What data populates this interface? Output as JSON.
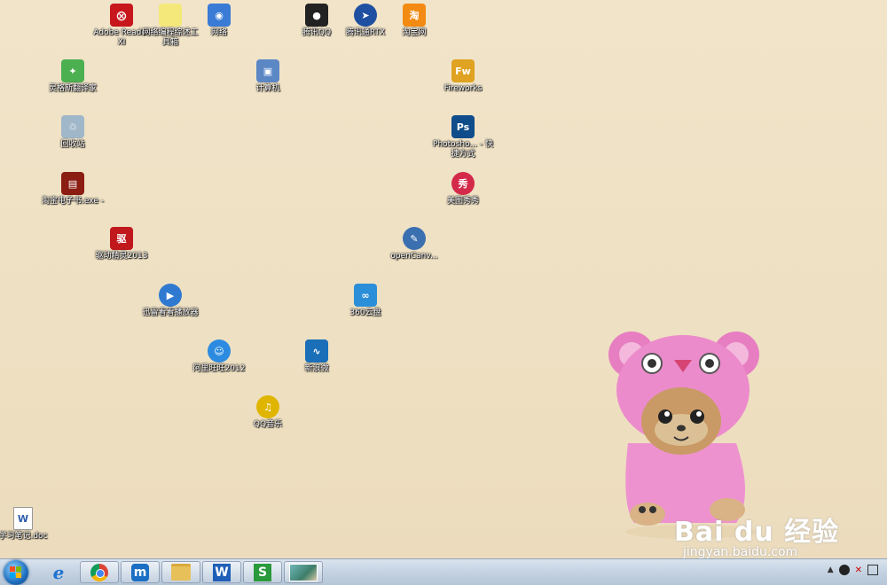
{
  "desktop": {
    "icons": [
      {
        "label": "Adobe Reader XI",
        "glyph": "⨂",
        "color": "#c8161d",
        "icon": "adobe-reader-icon"
      },
      {
        "label": "网络编程综述工具箱",
        "glyph": "",
        "color": "#f5e87a",
        "icon": "sticky-note-icon"
      },
      {
        "label": "网络",
        "glyph": "◉",
        "color": "#3a7bd5",
        "icon": "network-icon"
      },
      {
        "label": "腾讯QQ",
        "glyph": "●",
        "color": "#222",
        "icon": "qq-icon"
      },
      {
        "label": "腾讯通RTX",
        "glyph": "➤",
        "color": "#1f4fa0",
        "icon": "rtx-icon"
      },
      {
        "label": "淘宝网",
        "glyph": "淘",
        "color": "#f38a12",
        "icon": "taobao-icon"
      },
      {
        "label": "灵格斯翻译家",
        "glyph": "✦",
        "color": "#4caf50",
        "icon": "lingoes-icon"
      },
      {
        "label": "计算机",
        "glyph": "▣",
        "color": "#5b87c5",
        "icon": "computer-icon"
      },
      {
        "label": "Fireworks",
        "glyph": "Fw",
        "color": "#e0a321",
        "icon": "fireworks-icon"
      },
      {
        "label": "回收站",
        "glyph": "♲",
        "color": "#9fb7c9",
        "icon": "recycle-bin-icon"
      },
      {
        "label": "Photosho... - 快捷方式",
        "glyph": "Ps",
        "color": "#0f4c8a",
        "icon": "photoshop-icon"
      },
      {
        "label": "淘宝电子书.exe -",
        "glyph": "▤",
        "color": "#8b1d12",
        "icon": "ebook-icon"
      },
      {
        "label": "美图秀秀",
        "glyph": "秀",
        "color": "#d42a4a",
        "icon": "meitu-icon"
      },
      {
        "label": "驱动精灵2013",
        "glyph": "驱",
        "color": "#c0181c",
        "icon": "driver-genius-icon"
      },
      {
        "label": "openCanv...",
        "glyph": "✎",
        "color": "#3a6fb0",
        "icon": "opencanvas-icon"
      },
      {
        "label": "迅雷看看播放器",
        "glyph": "▶",
        "color": "#2f7ad0",
        "icon": "xunlei-kankan-icon"
      },
      {
        "label": "360云盘",
        "glyph": "∞",
        "color": "#2b8ed8",
        "icon": "cloud-disk-icon"
      },
      {
        "label": "阿里旺旺2012",
        "glyph": "☺",
        "color": "#2c8be0",
        "icon": "aliwangwang-icon"
      },
      {
        "label": "新浪微",
        "glyph": "∿",
        "color": "#1a6fb8",
        "icon": "weibo-icon"
      },
      {
        "label": "QQ音乐",
        "glyph": "♫",
        "color": "#e0b500",
        "icon": "qq-music-icon"
      },
      {
        "label": "学习笔记.doc",
        "glyph": "W",
        "color": "#ffffff",
        "icon": "word-doc-icon"
      }
    ]
  },
  "taskbar": {
    "items": [
      {
        "name": "ie",
        "glyph": "e",
        "color": "#1e73d2",
        "icon": "internet-explorer-icon"
      },
      {
        "name": "chrome",
        "glyph": "◎",
        "color": "#d93025",
        "icon": "chrome-icon"
      },
      {
        "name": "maxthon",
        "glyph": "m",
        "color": "#1a6fc4",
        "icon": "maxthon-icon"
      },
      {
        "name": "explorer",
        "glyph": "▭",
        "color": "#e7c05a",
        "icon": "folder-icon"
      },
      {
        "name": "wps-writer",
        "glyph": "W",
        "color": "#1f5fb8",
        "icon": "wps-writer-icon"
      },
      {
        "name": "wps-spreadsheet",
        "glyph": "S",
        "color": "#2a9a3c",
        "icon": "wps-spreadsheet-icon"
      },
      {
        "name": "image-viewer",
        "glyph": "▦",
        "color": "#5aa1a6",
        "icon": "image-viewer-icon"
      }
    ]
  },
  "watermark": {
    "brand": "Bai du 经验",
    "url": "jingyan.baidu.com"
  }
}
